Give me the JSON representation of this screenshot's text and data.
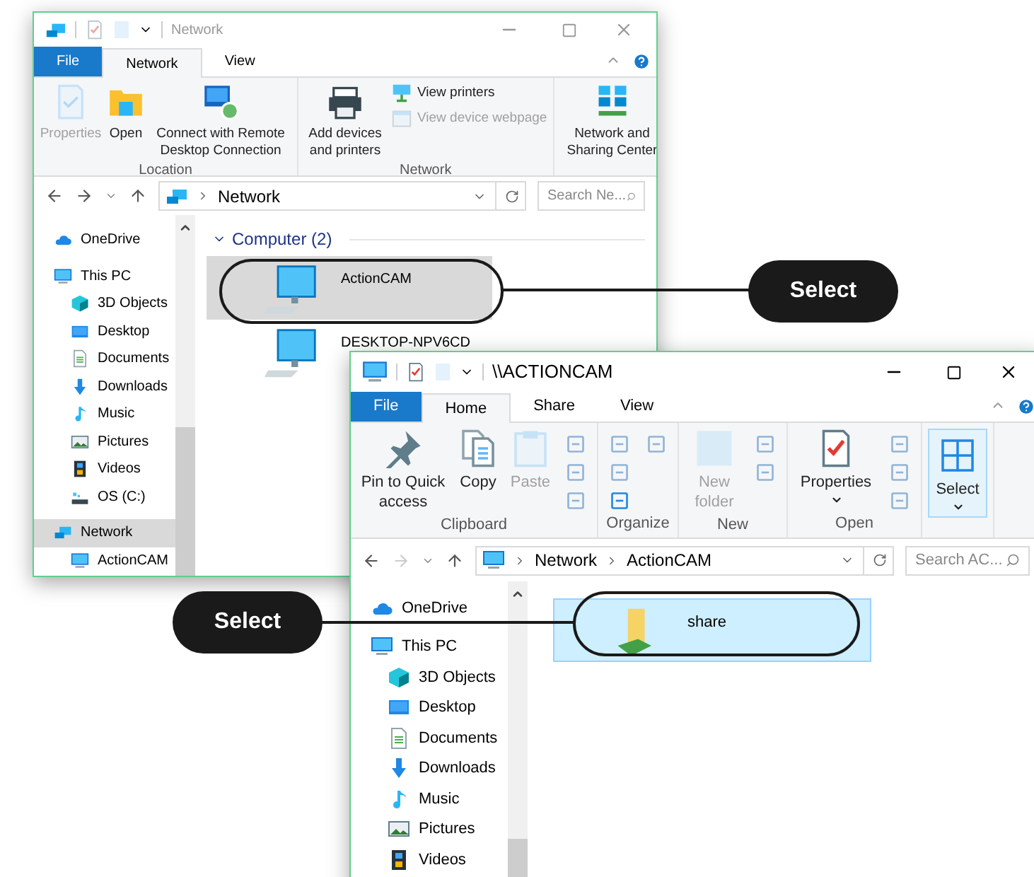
{
  "windows": [
    {
      "title": "Network",
      "active": false,
      "tabs": [
        {
          "label": "File",
          "kind": "file",
          "selected": false
        },
        {
          "label": "Network",
          "kind": "tab",
          "selected": true
        },
        {
          "label": "View",
          "kind": "tab",
          "selected": false
        }
      ],
      "ribbon": [
        {
          "label": "Location",
          "large": [
            {
              "label": "Properties",
              "kind": "properties",
              "disabled": true
            },
            {
              "label": "Open",
              "kind": "open",
              "disabled": false
            },
            {
              "label": "Connect with Remote Desktop Connection",
              "kind": "remote",
              "disabled": false
            }
          ]
        },
        {
          "label": "Network",
          "large": [
            {
              "label": "Add devices and printers",
              "kind": "printer",
              "disabled": false
            }
          ],
          "small": [
            {
              "label": "View printers",
              "kind": "printers",
              "disabled": false
            },
            {
              "label": "View device webpage",
              "kind": "webpage",
              "disabled": true
            }
          ]
        },
        {
          "large": [
            {
              "label": "Network and Sharing Center",
              "kind": "sharing",
              "disabled": false
            }
          ]
        }
      ],
      "address": {
        "crumbs": [
          "Network"
        ],
        "kind": "network",
        "search_placeholder": "Search Ne..."
      },
      "nav": [
        {
          "label": "OneDrive",
          "kind": "cloud",
          "selected": false
        },
        {
          "label": "This PC",
          "kind": "pc",
          "selected": false,
          "children": [
            {
              "label": "3D Objects",
              "kind": "objects3d",
              "selected": false
            },
            {
              "label": "Desktop",
              "kind": "desktop",
              "selected": false
            },
            {
              "label": "Documents",
              "kind": "documents",
              "selected": false
            },
            {
              "label": "Downloads",
              "kind": "downloads",
              "selected": false
            },
            {
              "label": "Music",
              "kind": "music",
              "selected": false
            },
            {
              "label": "Pictures",
              "kind": "pictures",
              "selected": false
            },
            {
              "label": "Videos",
              "kind": "videos",
              "selected": false
            },
            {
              "label": "OS (C:)",
              "kind": "drive",
              "selected": false
            }
          ]
        },
        {
          "label": "Network",
          "kind": "network",
          "selected": true,
          "children": [
            {
              "label": "ActionCAM",
              "kind": "pc",
              "selected": false
            }
          ]
        }
      ],
      "group": {
        "label": "Computer (2)",
        "expanded": true
      },
      "content": [
        {
          "label": "ActionCAM",
          "kind": "computer",
          "selected": true
        },
        {
          "label": "DESKTOP-NPV6CD",
          "kind": "computer",
          "selected": false
        }
      ]
    },
    {
      "title": "\\\\ACTIONCAM",
      "active": true,
      "tabs": [
        {
          "label": "File",
          "kind": "file",
          "selected": false
        },
        {
          "label": "Home",
          "kind": "tab",
          "selected": true
        },
        {
          "label": "Share",
          "kind": "tab",
          "selected": false
        },
        {
          "label": "View",
          "kind": "tab",
          "selected": false
        }
      ],
      "ribbon": [
        {
          "label": "Clipboard",
          "large": [
            {
              "label": "Pin to Quick access",
              "kind": "pin",
              "disabled": false
            },
            {
              "label": "Copy",
              "kind": "copy",
              "disabled": false
            },
            {
              "label": "Paste",
              "kind": "paste",
              "disabled": true
            }
          ]
        },
        {
          "label": "Organize"
        },
        {
          "label": "New",
          "large": [
            {
              "label": "New folder",
              "kind": "newfolder",
              "disabled": true
            }
          ]
        },
        {
          "label": "Open",
          "large": [
            {
              "label": "Properties",
              "kind": "docprops",
              "disabled": false,
              "dropdown": true
            }
          ]
        },
        {
          "large": [
            {
              "label": "Select",
              "kind": "select",
              "disabled": false,
              "dropdown": true,
              "highlighted": true
            }
          ]
        }
      ],
      "address": {
        "crumbs": [
          "Network",
          "ActionCAM"
        ],
        "kind": "pc",
        "search_placeholder": "Search AC..."
      },
      "nav": [
        {
          "label": "OneDrive",
          "kind": "cloud",
          "selected": false
        },
        {
          "label": "This PC",
          "kind": "pc",
          "selected": false,
          "children": [
            {
              "label": "3D Objects",
              "kind": "objects3d",
              "selected": false
            },
            {
              "label": "Desktop",
              "kind": "desktop",
              "selected": false
            },
            {
              "label": "Documents",
              "kind": "documents",
              "selected": false
            },
            {
              "label": "Downloads",
              "kind": "downloads",
              "selected": false
            },
            {
              "label": "Music",
              "kind": "music",
              "selected": false
            },
            {
              "label": "Pictures",
              "kind": "pictures",
              "selected": false
            },
            {
              "label": "Videos",
              "kind": "videos",
              "selected": false
            }
          ]
        }
      ],
      "content": [
        {
          "label": "share",
          "kind": "share",
          "selected": true
        }
      ]
    }
  ],
  "callouts": [
    {
      "label": "Select"
    },
    {
      "label": "Select"
    }
  ]
}
